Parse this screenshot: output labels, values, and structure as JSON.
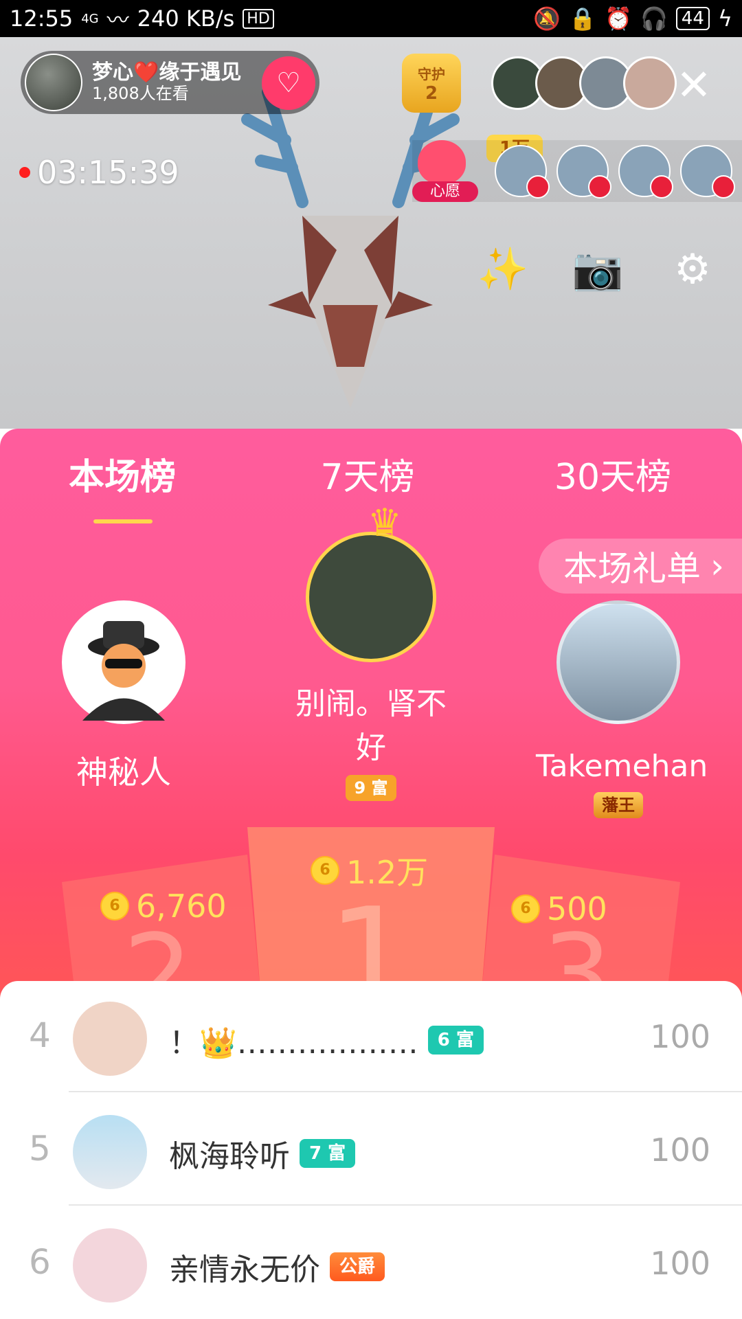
{
  "status_bar": {
    "time": "12:55",
    "network": "4G",
    "speed": "240 KB/s",
    "hd": "HD",
    "battery": "44"
  },
  "live": {
    "room_title": "梦心❤️缘于遇见",
    "viewers": "1,808人在看",
    "guard_label": "守护",
    "guard_count": "2",
    "top_fan_badge": "1万",
    "timer": "03:15:39",
    "wish_label": "心愿",
    "close_icon": "close-icon"
  },
  "ranking": {
    "tabs": [
      "本场榜",
      "7天榜",
      "30天榜"
    ],
    "gift_list_label": "本场礼单",
    "first": {
      "name": "别闹。肾不好",
      "badge": "9 富",
      "amount": "1.2万"
    },
    "second": {
      "name": "神秘人",
      "amount": "6,760"
    },
    "third": {
      "name": "Takemehan",
      "badge": "藩王",
      "amount": "500"
    }
  },
  "list": [
    {
      "rank": "4",
      "name": "！👑………………",
      "badge": "6 富",
      "score": "100"
    },
    {
      "rank": "5",
      "name": "枫海聆听",
      "badge": "7 富",
      "score": "100"
    },
    {
      "rank": "6",
      "name": "亲情永无价",
      "badge": "公爵",
      "score": "100"
    }
  ],
  "colors": {
    "panel_pink": "#ff5c9d",
    "panel_red": "#ff5657",
    "accent_yellow": "#ffd64d",
    "coin_text": "#ffe25c",
    "rich_teal": "#1ec8b0"
  }
}
